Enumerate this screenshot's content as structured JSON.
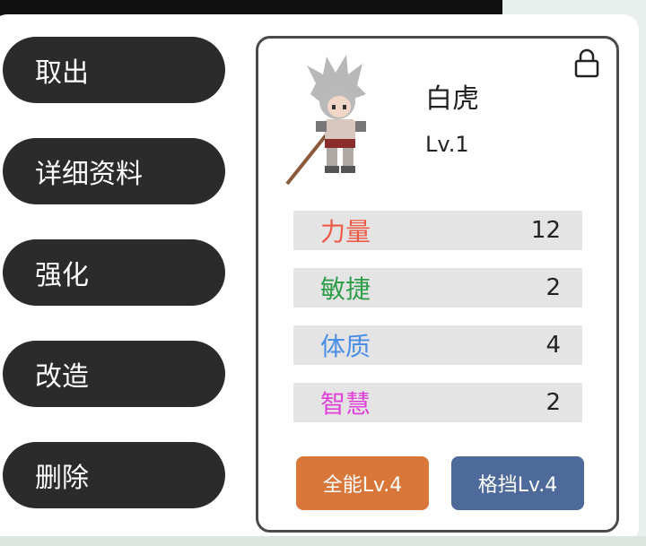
{
  "menu": {
    "items": [
      {
        "name": "cancel-button",
        "label": "取出"
      },
      {
        "name": "details-button",
        "label": "详细资料"
      },
      {
        "name": "enhance-button",
        "label": "强化"
      },
      {
        "name": "modify-button",
        "label": "改造"
      },
      {
        "name": "delete-button",
        "label": "删除"
      }
    ]
  },
  "hero": {
    "name": "白虎",
    "level": "Lv.1",
    "lock_icon": "lock-icon"
  },
  "stats": [
    {
      "label": "力量",
      "value": "12",
      "color": "#ef5a47"
    },
    {
      "label": "敏捷",
      "value": "2",
      "color": "#2e9e4a"
    },
    {
      "label": "体质",
      "value": "4",
      "color": "#4a8ee8"
    },
    {
      "label": "智慧",
      "value": "2",
      "color": "#e040d8"
    }
  ],
  "skills": [
    {
      "label": "全能Lv.4",
      "color": "#d9763a"
    },
    {
      "label": "格挡Lv.4",
      "color": "#4d6a9a"
    }
  ],
  "colors": {
    "menu_button": "#2b2b2b",
    "panel_border": "#4a4a4a",
    "stat_bar": "#e4e4e4"
  }
}
